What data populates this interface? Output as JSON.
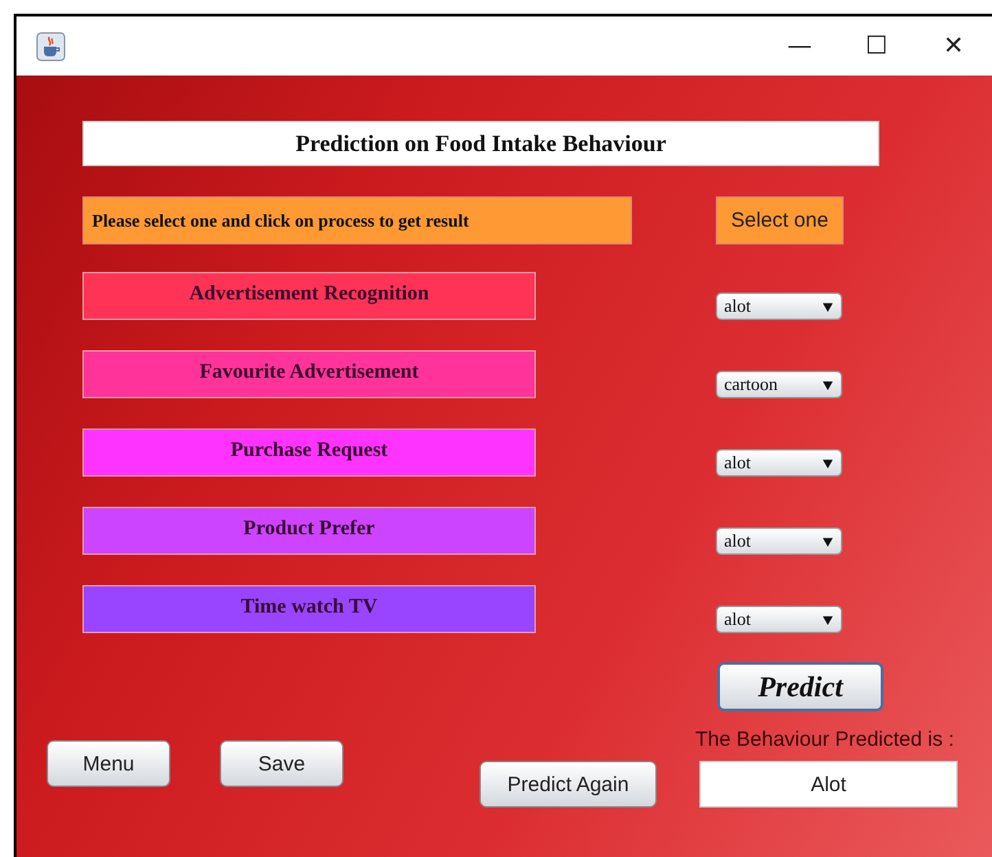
{
  "window": {
    "controls": [
      "—",
      "☐",
      "✕"
    ]
  },
  "title": "Prediction on Food Intake Behaviour",
  "instruction": "Please select one and click on process to get result",
  "select_label": "Select one",
  "rows": [
    {
      "label": "Advertisement Recognition",
      "value": "alot",
      "color": "#ff3355"
    },
    {
      "label": "Favourite Advertisement",
      "value": "cartoon",
      "color": "#ff3399"
    },
    {
      "label": "Purchase Request",
      "value": "alot",
      "color": "#ff33ff"
    },
    {
      "label": "Product Prefer",
      "value": "alot",
      "color": "#cc44ff"
    },
    {
      "label": "Time watch TV",
      "value": "alot",
      "color": "#9944ff"
    }
  ],
  "predict_button": "Predict",
  "buttons": [
    "Menu",
    "Save"
  ],
  "predict_again_button": "Predict Again",
  "result_label": "The Behaviour Predicted is :",
  "result_value": "Alot"
}
